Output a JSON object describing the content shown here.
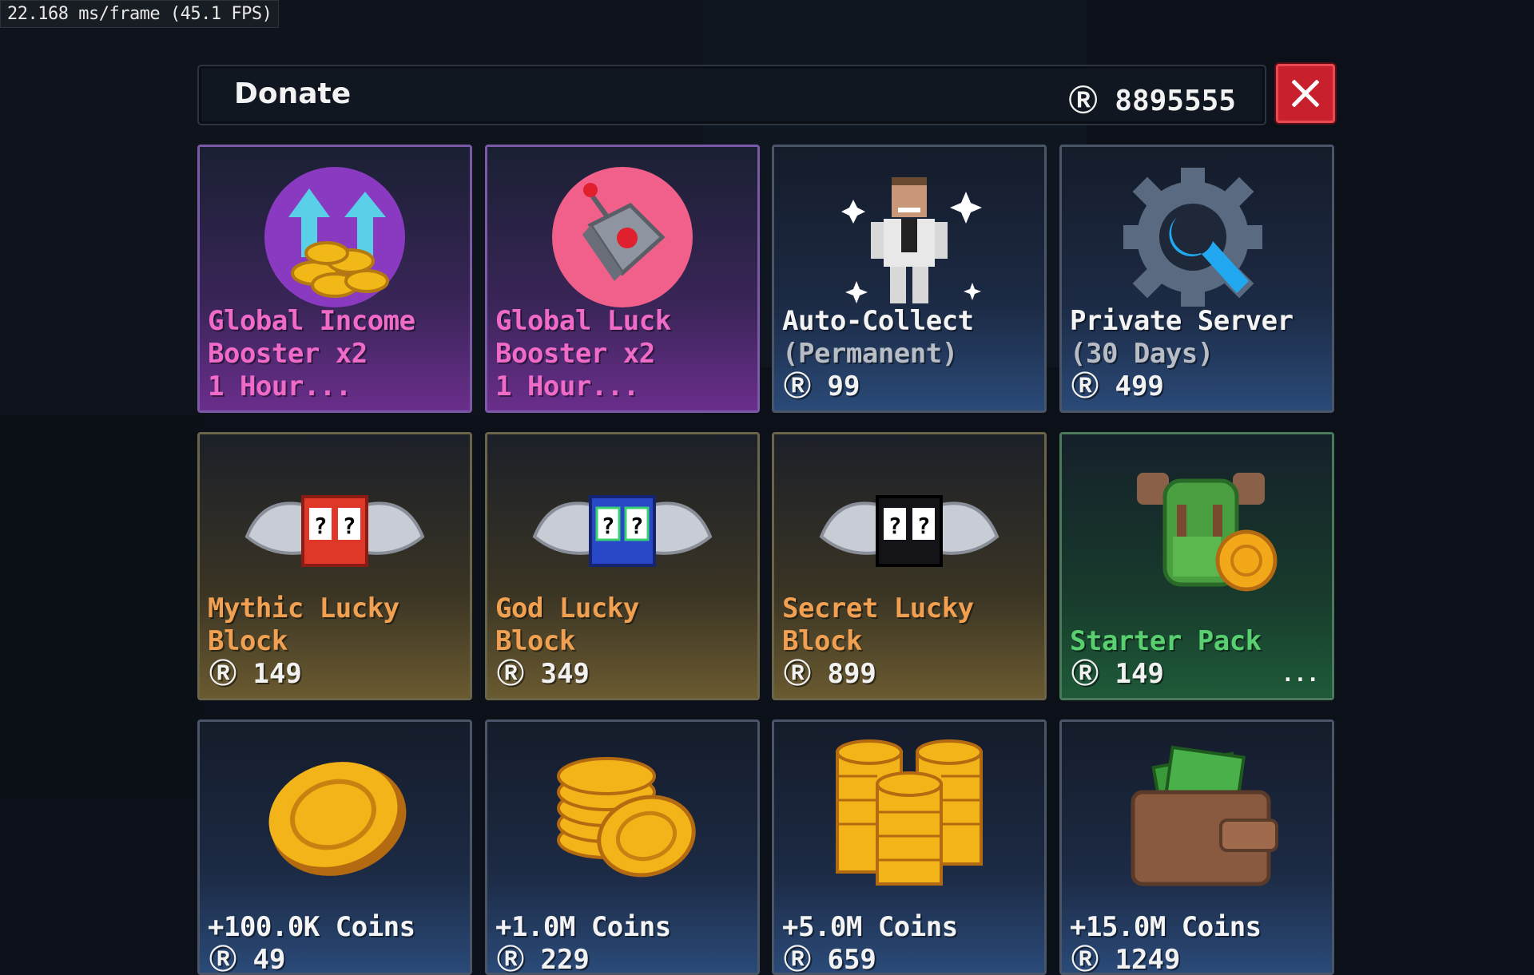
{
  "debug": {
    "fps_text": "22.168 ms/frame (45.1 FPS)"
  },
  "header": {
    "title": "Donate",
    "balance": "Ⓡ 8895555",
    "close_icon": "close-x-icon"
  },
  "colors": {
    "close_red": "#c8202c",
    "pink_label": "#f06ac8",
    "orange_label": "#f0a050",
    "green_label": "#58d070"
  },
  "items": [
    {
      "title": "Global Income\nBooster x2\n1 Hour...",
      "price": "",
      "icon": "income-booster-icon"
    },
    {
      "title": "Global Luck\nBooster x2\n1 Hour...",
      "price": "",
      "icon": "luck-booster-icon"
    },
    {
      "title": "Auto-Collect",
      "subtitle": "(Permanent)",
      "price": "Ⓡ 99",
      "icon": "auto-collect-character-icon"
    },
    {
      "title": "Private Server",
      "subtitle": "(30 Days)",
      "price": "Ⓡ 499",
      "icon": "private-server-gear-icon"
    },
    {
      "title": "Mythic Lucky\nBlock",
      "price": "Ⓡ 149",
      "icon": "mythic-lucky-block-icon"
    },
    {
      "title": "God Lucky\nBlock",
      "price": "Ⓡ 349",
      "icon": "god-lucky-block-icon"
    },
    {
      "title": "Secret Lucky\nBlock",
      "price": "Ⓡ 899",
      "icon": "secret-lucky-block-icon"
    },
    {
      "title": "Starter Pack",
      "price": "Ⓡ 149",
      "more": "...",
      "icon": "starter-pack-backpack-icon"
    },
    {
      "title": "+100.0K Coins",
      "price": "Ⓡ 49",
      "icon": "single-coin-icon"
    },
    {
      "title": "+1.0M Coins",
      "price": "Ⓡ 229",
      "icon": "coin-stack-icon"
    },
    {
      "title": "+5.0M Coins",
      "price": "Ⓡ 659",
      "icon": "coin-piles-icon"
    },
    {
      "title": "+15.0M Coins",
      "price": "Ⓡ 1249",
      "icon": "wallet-cash-icon"
    }
  ]
}
